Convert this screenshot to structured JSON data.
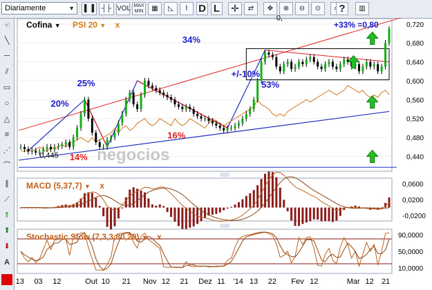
{
  "toolbar": {
    "period": "Diariamente",
    "buttons": [
      "VOL",
      "MAX",
      "MIN",
      "D",
      "L",
      "?"
    ]
  },
  "header": {
    "instrument": "Cofina",
    "indicator": "PSI 20",
    "close": "x",
    "summary": "+33% =0,80"
  },
  "colors": {
    "up": "#12b012",
    "down": "#e02020",
    "price": "#000000",
    "psi": "#d07a1e",
    "trend_red": "#e02020",
    "trend_blue": "#2030c0",
    "annot_blue": "#1a1ad0",
    "annot_red": "#e02020",
    "signal_arrow": "#22c022"
  },
  "chart_data": [
    {
      "type": "candlestick",
      "title": "Cofina",
      "series": [
        {
          "name": "Cofina",
          "note": "daily closes approximated from chart",
          "values": [
            0.46,
            0.455,
            0.45,
            0.452,
            0.448,
            0.45,
            0.455,
            0.46,
            0.455,
            0.46,
            0.462,
            0.465,
            0.47,
            0.46,
            0.48,
            0.5,
            0.53,
            0.56,
            0.52,
            0.49,
            0.47,
            0.46,
            0.46,
            0.475,
            0.48,
            0.49,
            0.51,
            0.53,
            0.56,
            0.575,
            0.55,
            0.54,
            0.57,
            0.6,
            0.59,
            0.585,
            0.58,
            0.575,
            0.57,
            0.565,
            0.56,
            0.55,
            0.545,
            0.54,
            0.545,
            0.54,
            0.53,
            0.525,
            0.52,
            0.52,
            0.515,
            0.51,
            0.505,
            0.5,
            0.495,
            0.5,
            0.5,
            0.505,
            0.51,
            0.52,
            0.53,
            0.54,
            0.56,
            0.6,
            0.64,
            0.66,
            0.655,
            0.65,
            0.63,
            0.62,
            0.635,
            0.64,
            0.625,
            0.63,
            0.64,
            0.635,
            0.645,
            0.65,
            0.64,
            0.63,
            0.625,
            0.635,
            0.64,
            0.63,
            0.625,
            0.635,
            0.645,
            0.64,
            0.63,
            0.635,
            0.62,
            0.63,
            0.64,
            0.63,
            0.635,
            0.62,
            0.63,
            0.68,
            0.71
          ]
        },
        {
          "name": "PSI 20",
          "note": "relative performance line"
        }
      ],
      "ylim": [
        0.41,
        0.73
      ],
      "y_ticks": [
        "0,720",
        "0,680",
        "0,640",
        "0,600",
        "0,560",
        "0,520",
        "0,480",
        "0,440"
      ],
      "annotations": [
        {
          "text": "20%",
          "color": "blue"
        },
        {
          "text": "25%",
          "color": "blue"
        },
        {
          "text": "34%",
          "color": "blue"
        },
        {
          "text": "14%",
          "color": "red"
        },
        {
          "text": "16%",
          "color": "red"
        },
        {
          "text": "+/-10%",
          "color": "blue"
        },
        {
          "text": "53%",
          "color": "blue"
        },
        {
          "text": "0,445",
          "color": "black"
        },
        {
          "text": "0,",
          "color": "black"
        }
      ],
      "watermark": "negocios"
    },
    {
      "type": "line",
      "title": "MACD (5,37,7)",
      "y_ticks": [
        "0,0600",
        "0,0200",
        "-0,0200"
      ],
      "series": [
        {
          "name": "MACD"
        },
        {
          "name": "Signal"
        },
        {
          "name": "Histogram"
        }
      ]
    },
    {
      "type": "line",
      "title": "Stochastic Slow (7,3,3,80,20)",
      "y_ticks": [
        "90,0000",
        "50,0000",
        "10,0000"
      ],
      "series": [
        {
          "name": "%K"
        },
        {
          "name": "%D"
        }
      ]
    }
  ],
  "x_axis": {
    "labels": [
      "13",
      "03",
      "12",
      "Out",
      "10",
      "21",
      "Nov",
      "12",
      "21",
      "Dez",
      "11",
      "'14",
      "13",
      "22",
      "Fev",
      "12",
      "Mar",
      "12",
      "21"
    ]
  }
}
